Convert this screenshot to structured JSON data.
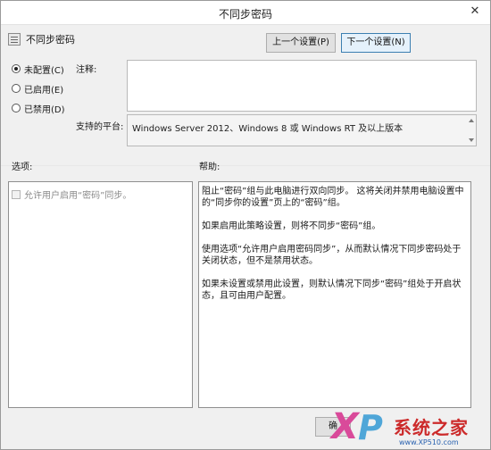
{
  "window": {
    "title": "不同步密码",
    "close_glyph": "✕"
  },
  "header": {
    "policy_name": "不同步密码",
    "prev_button": "上一个设置(P)",
    "next_button": "下一个设置(N)"
  },
  "state_options": {
    "not_configured": "未配置(C)",
    "enabled": "已启用(E)",
    "disabled": "已禁用(D)",
    "selected": "not_configured"
  },
  "comment": {
    "label": "注释:",
    "value": ""
  },
  "supported_on": {
    "label": "支持的平台:",
    "value": "Windows Server 2012、Windows 8 或 Windows RT 及以上版本"
  },
  "options": {
    "label": "选项:",
    "items": [
      {
        "label": "允许用户启用“密码”同步。",
        "checked": false,
        "enabled": false
      }
    ]
  },
  "help": {
    "label": "帮助:",
    "paragraphs": [
      "阻止“密码”组与此电脑进行双向同步。 这将关闭并禁用电脑设置中的“同步你的设置”页上的“密码”组。",
      "如果启用此策略设置，则将不同步“密码”组。",
      "使用选项“允许用户启用密码同步”，从而默认情况下同步密码处于关闭状态，但不是禁用状态。",
      "如果未设置或禁用此设置，则默认情况下同步“密码”组处于开启状态，且可由用户配置。"
    ]
  },
  "footer": {
    "partial_button": "确"
  },
  "watermark": {
    "x": "X",
    "p": "P",
    "brand": "系统之家",
    "url": "www.XP510.com"
  },
  "colors": {
    "accent_border": "#3c7fb1",
    "window_bg": "#f0f0f0"
  }
}
